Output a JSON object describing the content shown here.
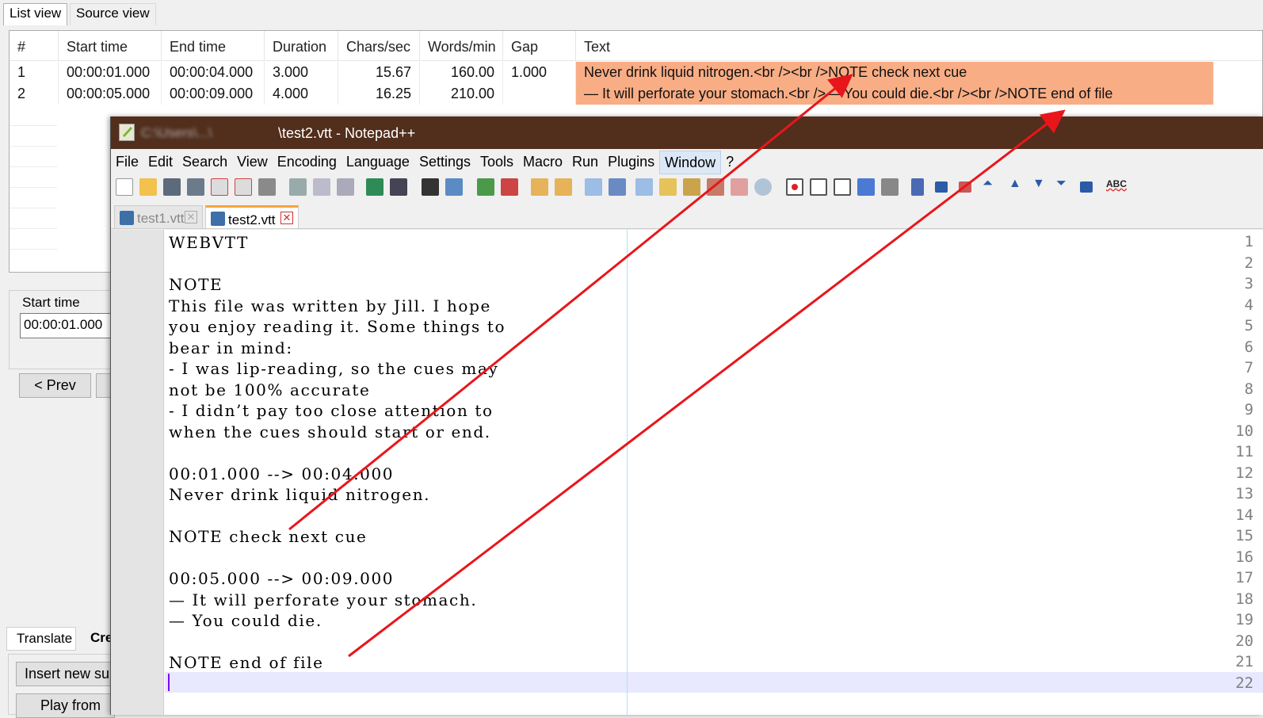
{
  "app_tabs": {
    "list_view": "List view",
    "source_view": "Source view"
  },
  "grid": {
    "columns": [
      "#",
      "Start time",
      "End time",
      "Duration",
      "Chars/sec",
      "Words/min",
      "Gap",
      "Text"
    ],
    "rows": [
      [
        "1",
        "00:00:01.000",
        "00:00:04.000",
        "3.000",
        "15.67",
        "160.00",
        "1.000",
        "Never drink liquid nitrogen.<br /><br />NOTE check next cue"
      ],
      [
        "2",
        "00:00:05.000",
        "00:00:09.000",
        "4.000",
        "16.25",
        "210.00",
        "",
        "— It will perforate your stomach.<br />— You could die.<br /><br />NOTE end of file"
      ]
    ],
    "highlight_color": "#f9ad85"
  },
  "lower_panel": {
    "start_time_label": "Start time",
    "start_time_value": "00:00:01.000",
    "prev_button": "< Prev",
    "tabs": [
      "Translate",
      "Cre"
    ],
    "insert_button": "Insert new sub",
    "play_button": "Play from"
  },
  "npp": {
    "title_path": "C:\\Users\\...\\",
    "title": "\\test2.vtt - Notepad++",
    "menu": [
      "File",
      "Edit",
      "Search",
      "View",
      "Encoding",
      "Language",
      "Settings",
      "Tools",
      "Macro",
      "Run",
      "Plugins",
      "Window",
      "?"
    ],
    "tabs": [
      "test1.vtt",
      "test2.vtt"
    ],
    "lines": [
      "WEBVTT",
      "",
      "NOTE",
      "This file was written by Jill. I hope",
      "you enjoy reading it. Some things to",
      "bear in mind:",
      "- I was lip-reading, so the cues may",
      "not be 100% accurate",
      "- I didn’t pay too close attention to",
      "when the cues should start or end.",
      "",
      "00:01.000 --> 00:04.000",
      "Never drink liquid nitrogen.",
      "",
      "NOTE check next cue",
      "",
      "00:05.000 --> 00:09.000",
      "— It will perforate your stomach.",
      "— You could die.",
      "",
      "NOTE end of file",
      ""
    ]
  },
  "colors": {
    "titlebar": "#522e1c",
    "annotation_arrow": "#e8161b"
  }
}
